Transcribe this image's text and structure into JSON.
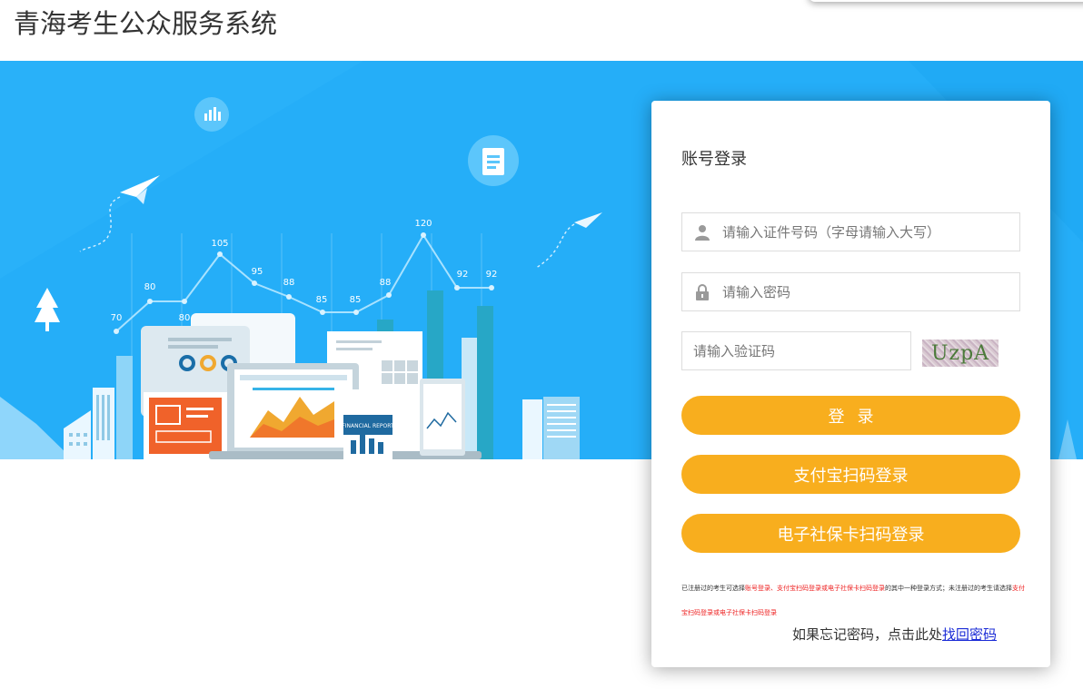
{
  "header": {
    "title": "青海考生公众服务系统"
  },
  "banner": {
    "chart_points": [
      "70",
      "80",
      "80",
      "105",
      "95",
      "88",
      "85",
      "85",
      "88",
      "120",
      "92",
      "92"
    ],
    "report_label": "FINANCIAL REPORT"
  },
  "login": {
    "title": "账号登录",
    "id_placeholder": "请输入证件号码（字母请输入大写）",
    "password_placeholder": "请输入密码",
    "captcha_placeholder": "请输入验证码",
    "captcha_text": "UzpA",
    "login_label": "登录",
    "alipay_label": "支付宝扫码登录",
    "ecard_label": "电子社保卡扫码登录",
    "notice": {
      "part1": "已注册过的考生可选择",
      "part2": "账号登录、支付宝扫码登录或电子社保卡扫码登录",
      "part3": "的其中一种登录方式；未注册过的考生请选择",
      "part4": "支付宝扫码登录或电子社保卡扫码登录"
    },
    "forgot_text": "如果忘记密码，点击此处",
    "forgot_link": "找回密码"
  },
  "colors": {
    "banner": "#25aef8",
    "button": "#f8ae1e",
    "link": "#1a2bd6"
  }
}
